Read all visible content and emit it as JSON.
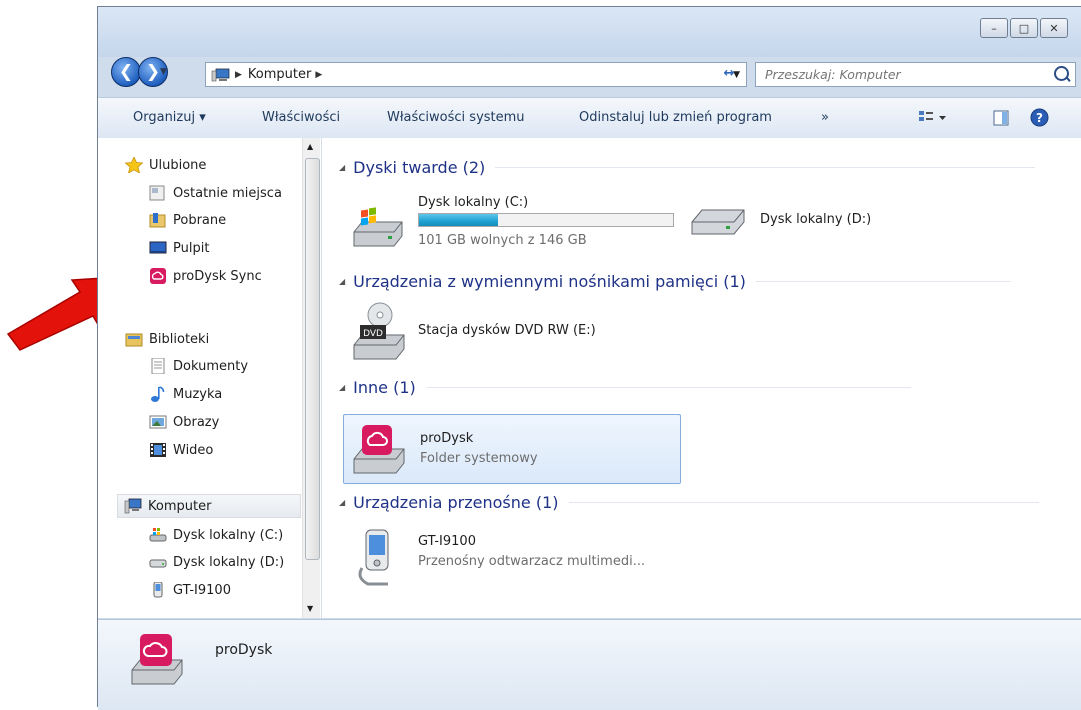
{
  "window": {
    "caption_buttons": {
      "minimize": "–",
      "maximize": "□",
      "close": "✕"
    }
  },
  "address": {
    "crumb": "Komputer",
    "search_placeholder": "Przeszukaj: Komputer"
  },
  "toolbar": {
    "organize": "Organizuj ▾",
    "properties": "Właściwości",
    "system_properties": "Właściwości systemu",
    "uninstall": "Odinstaluj lub zmień program",
    "more": "»"
  },
  "nav": {
    "favorites": "Ulubione",
    "recent": "Ostatnie miejsca",
    "downloads": "Pobrane",
    "desktop": "Pulpit",
    "prodysk_sync": "proDysk Sync",
    "libraries": "Biblioteki",
    "documents": "Dokumenty",
    "music": "Muzyka",
    "pictures": "Obrazy",
    "video": "Wideo",
    "computer": "Komputer",
    "drive_c": "Dysk lokalny (C:)",
    "drive_d": "Dysk lokalny (D:)",
    "phone": "GT-I9100"
  },
  "groups": {
    "hdd": "Dyski twarde (2)",
    "removable": "Urządzenia z wymiennymi nośnikami pamięci (1)",
    "other": "Inne (1)",
    "portable": "Urządzenia przenośne (1)"
  },
  "items": {
    "c_name": "Dysk lokalny (C:)",
    "c_free": "101 GB wolnych z 146 GB",
    "c_used_fraction": 0.31,
    "d_name": "Dysk lokalny (D:)",
    "dvd_name": "Stacja dysków DVD RW (E:)",
    "dvd_label": "DVD",
    "prodysk_name": "proDysk",
    "prodysk_type": "Folder systemowy",
    "phone_name": "GT-I9100",
    "phone_type": "Przenośny odtwarzacz multimedi..."
  },
  "details": {
    "name": "proDysk"
  },
  "colors": {
    "accent": "#2b64b9",
    "prodysk": "#d81b60",
    "arrow": "#e3120b"
  }
}
